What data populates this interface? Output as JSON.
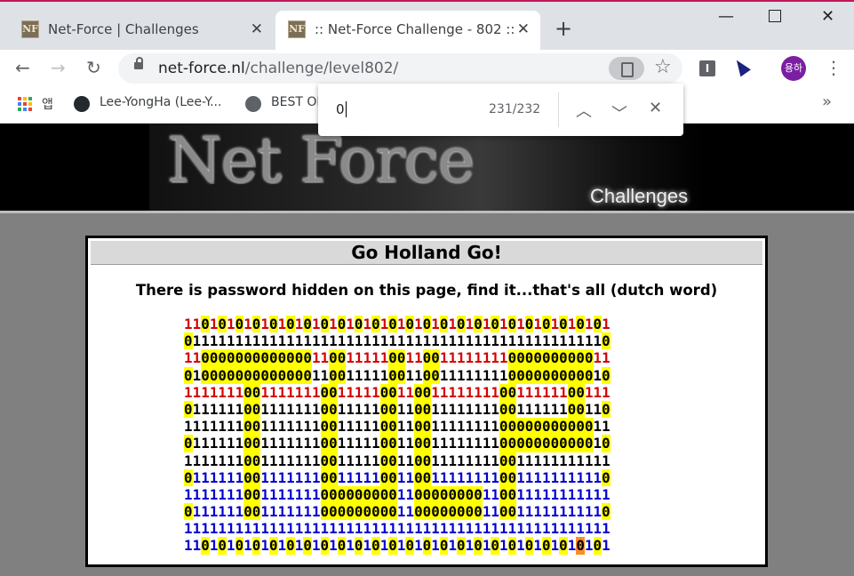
{
  "tabs": [
    {
      "title": "Net-Force | Challenges",
      "favicon": "NF"
    },
    {
      "title": ":: Net-Force Challenge - 802 ::",
      "favicon": "NF"
    }
  ],
  "address_bar": {
    "host": "net-force.nl",
    "path": "/challenge/level802/"
  },
  "profile": {
    "initials": "용하",
    "color": "#7b1fa2"
  },
  "bookmarks": [
    {
      "label": "앱",
      "icon": "apps-icon"
    },
    {
      "label": "Lee-YongHa (Lee-Y...",
      "icon": "github-icon"
    },
    {
      "label": "BEST OF",
      "icon": "globe-icon"
    }
  ],
  "find_bar": {
    "query": "0",
    "count": "231/232"
  },
  "banner": {
    "logo": "Net Force",
    "subtitle": "Challenges"
  },
  "panel": {
    "title": "Go Holland Go!",
    "instruction": "There is password hidden on this page, find it...that's all (dutch word)"
  },
  "grid": {
    "rows": [
      "11010101010101010101010101010101010101010101010101",
      "01111111111111111111111111111111111111111111111110",
      "11000000000000011001111100110011111111000000000011",
      "01000000000000011001111100110011111111000000000010",
      "11111110011111110011111001100111111110011111100111",
      "01111110011111110011111001100111111110011111100110",
      "11111110011111110011111001100111111110000000000011",
      "01111110011111110011111001100111111110000000000010",
      "11111110011111110011111001100111111110011111111111",
      "01111110011111110011111001100111111110011111111110",
      "11111110011111110000000001100000000110011111111111",
      "01111110011111110000000001100000000110011111111110",
      "11111111111111111111111111111111111111111111111111",
      "11010101010101010101010101010101010101010101010101"
    ],
    "colors": [
      "r",
      "k",
      "r",
      "k",
      "r",
      "k",
      "k",
      "k",
      "k",
      "b",
      "b",
      "b",
      "b",
      "b"
    ],
    "current_match": {
      "row": 13,
      "col": 46
    },
    "highlight_color": "#ffff00",
    "current_color": "#ff8c2a"
  }
}
